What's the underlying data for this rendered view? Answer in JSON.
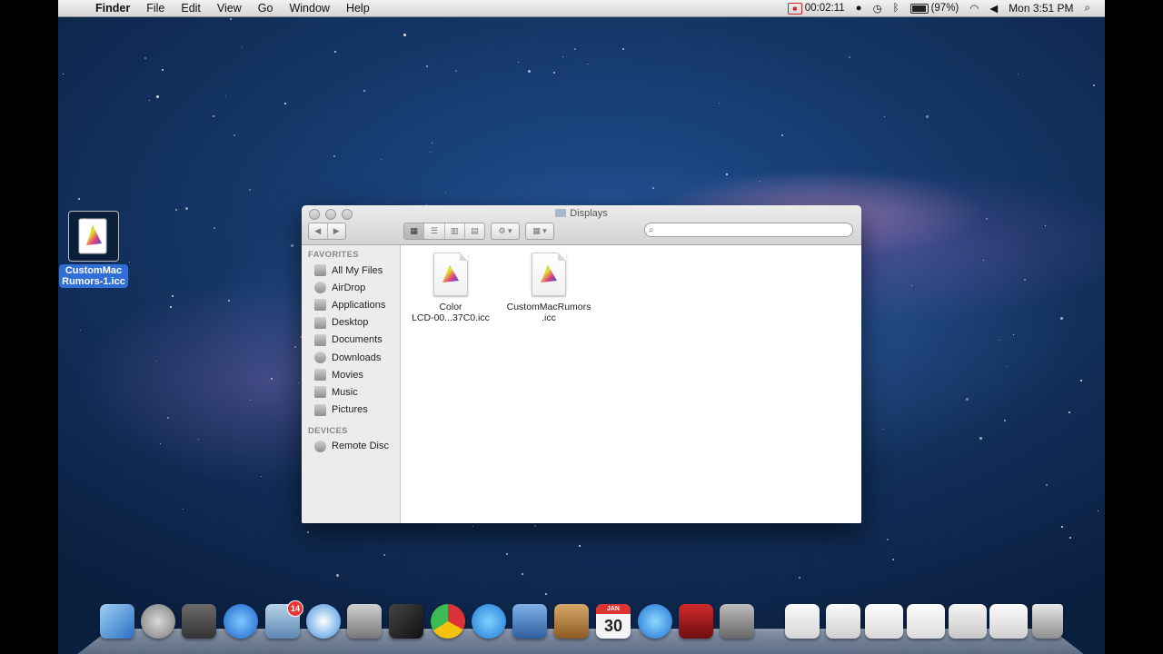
{
  "menubar": {
    "apple": "",
    "items": [
      "Finder",
      "File",
      "Edit",
      "View",
      "Go",
      "Window",
      "Help"
    ],
    "recording_time": "00:02:11",
    "battery": "(97%)",
    "battery_level": 0.97,
    "clock": "Mon 3:51 PM"
  },
  "desktop_icon": {
    "label": "CustomMacRumors-1.icc"
  },
  "finder": {
    "title": "Displays",
    "search": {
      "placeholder": ""
    },
    "sidebar": {
      "favorites_header": "FAVORITES",
      "favorites": [
        "All My Files",
        "AirDrop",
        "Applications",
        "Desktop",
        "Documents",
        "Downloads",
        "Movies",
        "Music",
        "Pictures"
      ],
      "devices_header": "DEVICES",
      "devices": [
        "Remote Disc"
      ]
    },
    "files": [
      {
        "line1": "Color",
        "line2": "LCD-00...37C0.icc"
      },
      {
        "line1": "CustomMacRumors",
        "line2": ".icc"
      }
    ]
  },
  "dock": {
    "mail_badge": "14",
    "calendar_day": "30",
    "calendar_month": "JAN"
  },
  "colors": {
    "selection": "#2f6fd6",
    "desktop": "#1f4d8f"
  }
}
